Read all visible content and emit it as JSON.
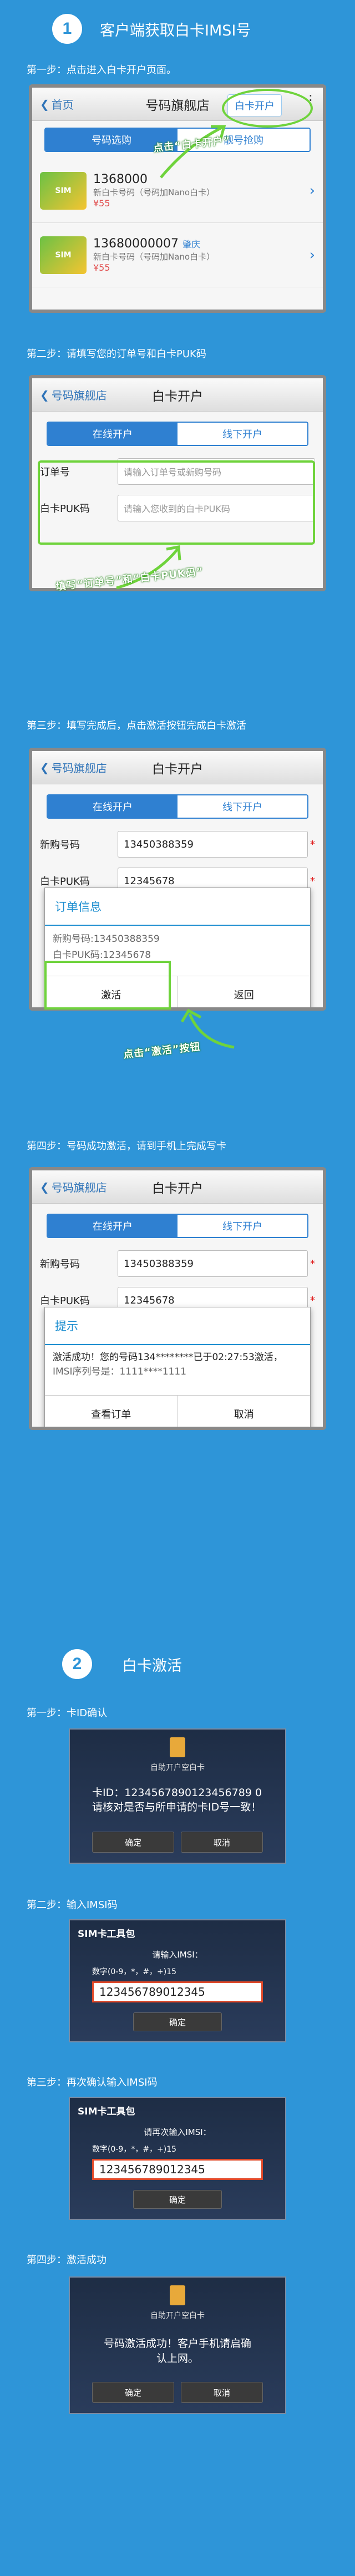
{
  "section1": {
    "number": "1",
    "title": "客户端获取白卡IMSI号"
  },
  "step1": {
    "caption": "第一步：点击进入白卡开户页面。",
    "back": "首页",
    "title": "号码旗舰店",
    "top_button": "白卡开户",
    "tabs": [
      "号码选购",
      "靓号抢购"
    ],
    "items": [
      {
        "number": "1368000",
        "region": "",
        "desc": "新白卡号码（号码加Nano白卡）",
        "price": "¥55"
      },
      {
        "number": "13680000007",
        "region": "肇庆",
        "desc": "新白卡号码（号码加Nano白卡）",
        "price": "¥55"
      }
    ],
    "annotation": "点击“白卡开户”"
  },
  "step2": {
    "caption": "第二步：请填写您的订单号和白卡PUK码",
    "back": "号码旗舰店",
    "title": "白卡开户",
    "tabs": [
      "在线开户",
      "线下开户"
    ],
    "order_label": "订单号",
    "order_placeholder": "请输入订单号或新购号码",
    "puk_label": "白卡PUK码",
    "puk_placeholder": "请输入您收到的白卡PUK码",
    "annotation": "填写“订单号”和“白卡PUK码”"
  },
  "step3": {
    "caption": "第三步：填写完成后，点击激活按钮完成白卡激活",
    "back": "号码旗舰店",
    "title": "白卡开户",
    "tabs": [
      "在线开户",
      "线下开户"
    ],
    "number_label": "新购号码",
    "number_value": "13450388359",
    "puk_label": "白卡PUK码",
    "puk_value": "12345678",
    "dialog_title": "订单信息",
    "dialog_line1": "新购号码:13450388359",
    "dialog_line2": "白卡PUK码:12345678",
    "activate": "激活",
    "return": "返回",
    "annotation": "点击“激活”按钮"
  },
  "step4": {
    "caption": "第四步：号码成功激活，请到手机上完成写卡",
    "back": "号码旗舰店",
    "title": "白卡开户",
    "tabs": [
      "在线开户",
      "线下开户"
    ],
    "number_label": "新购号码",
    "number_value": "13450388359",
    "puk_label": "白卡PUK码",
    "puk_value": "12345678",
    "dialog_title": "提示",
    "dialog_line1": "激活成功！您的号码134********已于02:27:53激活，",
    "dialog_line2": "IMSI序列号是：1111****1111",
    "view_order": "查看订单",
    "cancel": "取消"
  },
  "section2": {
    "number": "2",
    "title": "白卡激活"
  },
  "w1": {
    "caption": "第一步：卡ID确认",
    "title": "自助开户空白卡",
    "line1": "卡ID：1234567890123456789 0",
    "line2": "请核对是否与所申请的卡ID号一致！",
    "ok": "确定",
    "cancel": "取消"
  },
  "w2": {
    "caption": "第二步：输入IMSI码",
    "title": "SIM卡工具包",
    "prompt": "请输入IMSI：",
    "hint": "数字(0-9，*，#，+)15",
    "value": "123456789012345",
    "ok": "确定"
  },
  "w3": {
    "caption": "第三步：再次确认输入IMSI码",
    "title": "SIM卡工具包",
    "prompt": "请再次输入IMSI：",
    "hint": "数字(0-9，*，#，+)15",
    "value": "123456789012345",
    "ok": "确定"
  },
  "w4": {
    "caption": "第四步：激活成功",
    "title": "自助开户空白卡",
    "line1": "号码激活成功！客户手机请启确认上网。",
    "ok": "确定",
    "cancel": "取消"
  }
}
